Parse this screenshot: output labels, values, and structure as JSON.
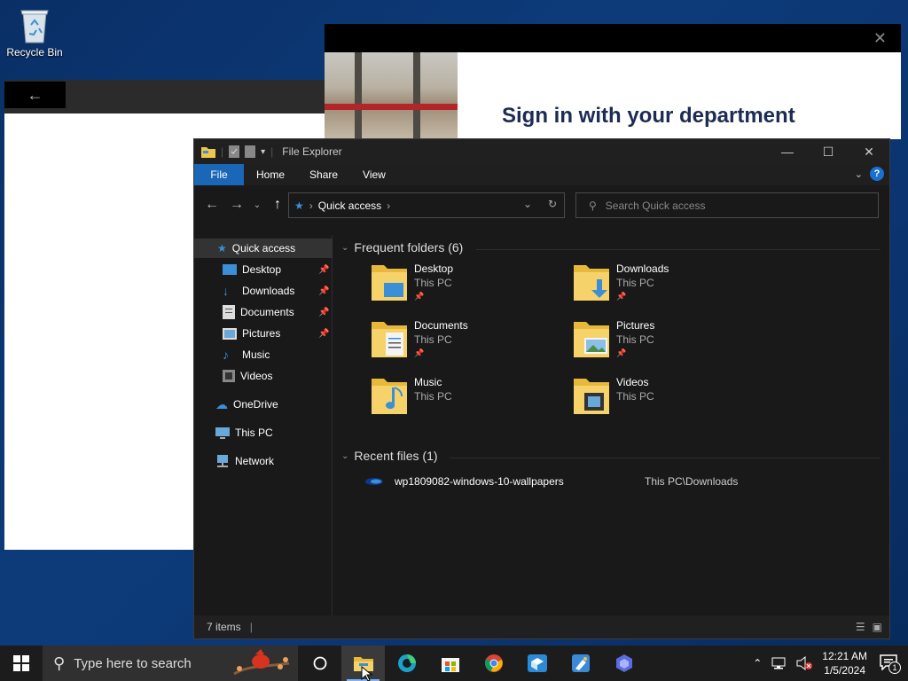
{
  "desktop": {
    "recycle_bin_label": "Recycle Bin"
  },
  "signin_window": {
    "heading": "Sign in with your department"
  },
  "explorer": {
    "title": "File Explorer",
    "ribbon_tabs": [
      "File",
      "Home",
      "Share",
      "View"
    ],
    "address": "Quick access",
    "search_placeholder": "Search Quick access",
    "nav": {
      "quick_access": "Quick access",
      "items": [
        "Desktop",
        "Downloads",
        "Documents",
        "Pictures",
        "Music",
        "Videos"
      ],
      "onedrive": "OneDrive",
      "this_pc": "This PC",
      "network": "Network"
    },
    "frequent_header": "Frequent folders (6)",
    "folders": [
      {
        "name": "Desktop",
        "location": "This PC",
        "pinned": true
      },
      {
        "name": "Downloads",
        "location": "This PC",
        "pinned": true
      },
      {
        "name": "Documents",
        "location": "This PC",
        "pinned": true
      },
      {
        "name": "Pictures",
        "location": "This PC",
        "pinned": true
      },
      {
        "name": "Music",
        "location": "This PC",
        "pinned": false
      },
      {
        "name": "Videos",
        "location": "This PC",
        "pinned": false
      }
    ],
    "recent_header": "Recent files (1)",
    "recent_files": [
      {
        "name": "wp1809082-windows-10-wallpapers",
        "path": "This PC\\Downloads"
      }
    ],
    "status": "7 items"
  },
  "taskbar": {
    "search_placeholder": "Type here to search",
    "clock_time": "12:21 AM",
    "clock_date": "1/5/2024",
    "notification_count": "1"
  },
  "colors": {
    "accent": "#1a67b8",
    "folder": "#f0c64a"
  }
}
